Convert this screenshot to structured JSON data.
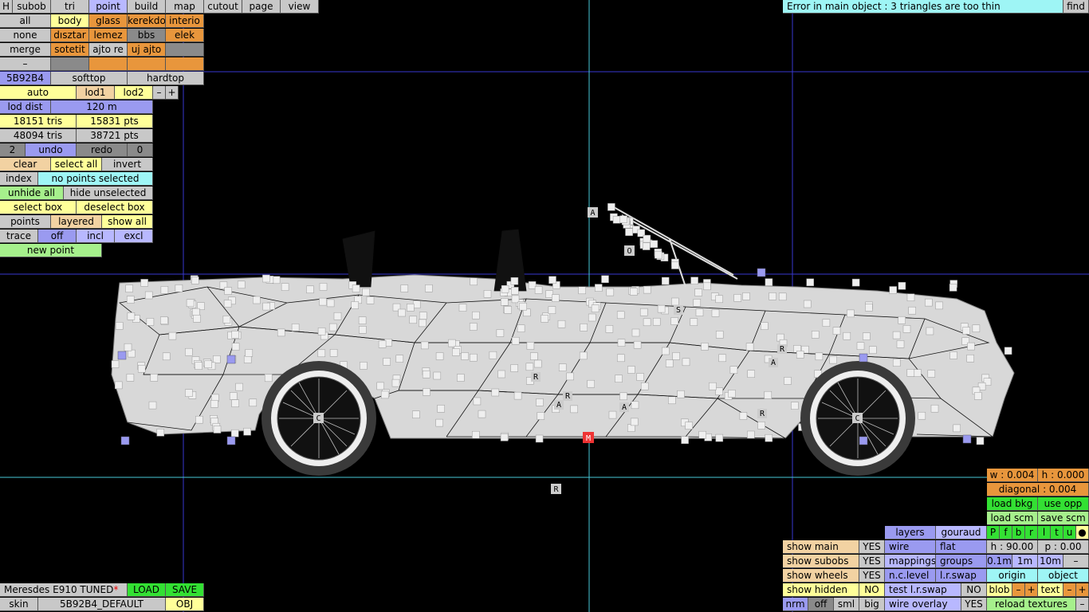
{
  "menu": {
    "h": "H",
    "subob": "subob",
    "tri": "tri",
    "point": "point",
    "build": "build",
    "map": "map",
    "cutout": "cutout",
    "page": "page",
    "view": "view"
  },
  "status": {
    "message": "Error in main object : 3 triangles are too thin",
    "find": "find"
  },
  "layers": {
    "row1": [
      "all",
      "body",
      "glass",
      "kerekdo",
      "interio"
    ],
    "row2": [
      "none",
      "dısztar",
      "lemez",
      "bbs",
      "elek"
    ],
    "row3": [
      "merge",
      "sotetit",
      "ajto re",
      "uj ajto",
      ""
    ],
    "row4": [
      "–",
      "",
      "",
      "",
      ""
    ]
  },
  "color": {
    "code": "5B92B4",
    "softtop": "softtop",
    "hardtop": "hardtop"
  },
  "lod": {
    "auto": "auto",
    "lod1": "lod1",
    "lod2": "lod2",
    "minus": "–",
    "plus": "+",
    "dist_label": "lod dist",
    "dist_value": "120 m"
  },
  "stats": {
    "tris1": "18151 tris",
    "pts1": "15831 pts",
    "tris2": "48094 tris",
    "pts2": "38721 pts"
  },
  "history": {
    "count": "2",
    "undo": "undo",
    "redo": "redo",
    "redo_count": "0"
  },
  "selection": {
    "clear": "clear",
    "select_all": "select all",
    "invert": "invert",
    "index": "index",
    "none_selected": "no points selected",
    "unhide_all": "unhide all",
    "hide_unselected": "hide unselected",
    "select_box": "select box",
    "deselect_box": "deselect box",
    "points": "points",
    "layered": "layered",
    "show_all": "show all",
    "trace": "trace",
    "off": "off",
    "incl": "incl",
    "excl": "excl",
    "new_point": "new point"
  },
  "file": {
    "name": "Meresdes E910 TUNED",
    "star": "*",
    "load": "LOAD",
    "save": "SAVE",
    "skin_label": "skin",
    "skin_value": "5B92B4_DEFAULT",
    "obj": "OBJ"
  },
  "viewport_labels": {
    "a1": "A",
    "o": "O",
    "r_bottom": "R",
    "m": "M",
    "c_left": "C",
    "c_right": "C",
    "r1": "R",
    "r2": "R",
    "a2": "A",
    "a3": "A",
    "r3": "R",
    "r4": "R",
    "a4": "A",
    "s": "S"
  },
  "right_panel": {
    "w": "w : 0.004",
    "h": "h : 0.000",
    "diagonal": "diagonal : 0.004",
    "load_bkg": "load bkg",
    "use_opp": "use opp",
    "load_scm": "load scm",
    "save_scm": "save scm",
    "letters": [
      "P",
      "f",
      "b",
      "r",
      "l",
      "t",
      "u",
      "●"
    ],
    "layers": "layers",
    "gouraud": "gouraud",
    "wire": "wire",
    "flat": "flat",
    "mappings": "mappings",
    "groups": "groups",
    "nc_level": "n.c.level",
    "lr_swap": "l.r.swap",
    "test_lr_swap": "test l.r.swap",
    "wire_overlay": "wire overlay",
    "show_main": "show main",
    "show_subobs": "show subobs",
    "show_wheels": "show wheels",
    "show_hidden": "show hidden",
    "yes": "YES",
    "no": "NO",
    "rot_h": "h : 90.00",
    "rot_p": "p : 0.00",
    "step1": "0.1m",
    "step2": "1m",
    "step3": "10m",
    "minus": "–",
    "origin": "origin",
    "object": "object",
    "blob": "blob",
    "text": "text",
    "plus": "+",
    "reload": "reload textures",
    "nrm": "nrm",
    "off": "off",
    "sml": "sml",
    "big": "big"
  }
}
